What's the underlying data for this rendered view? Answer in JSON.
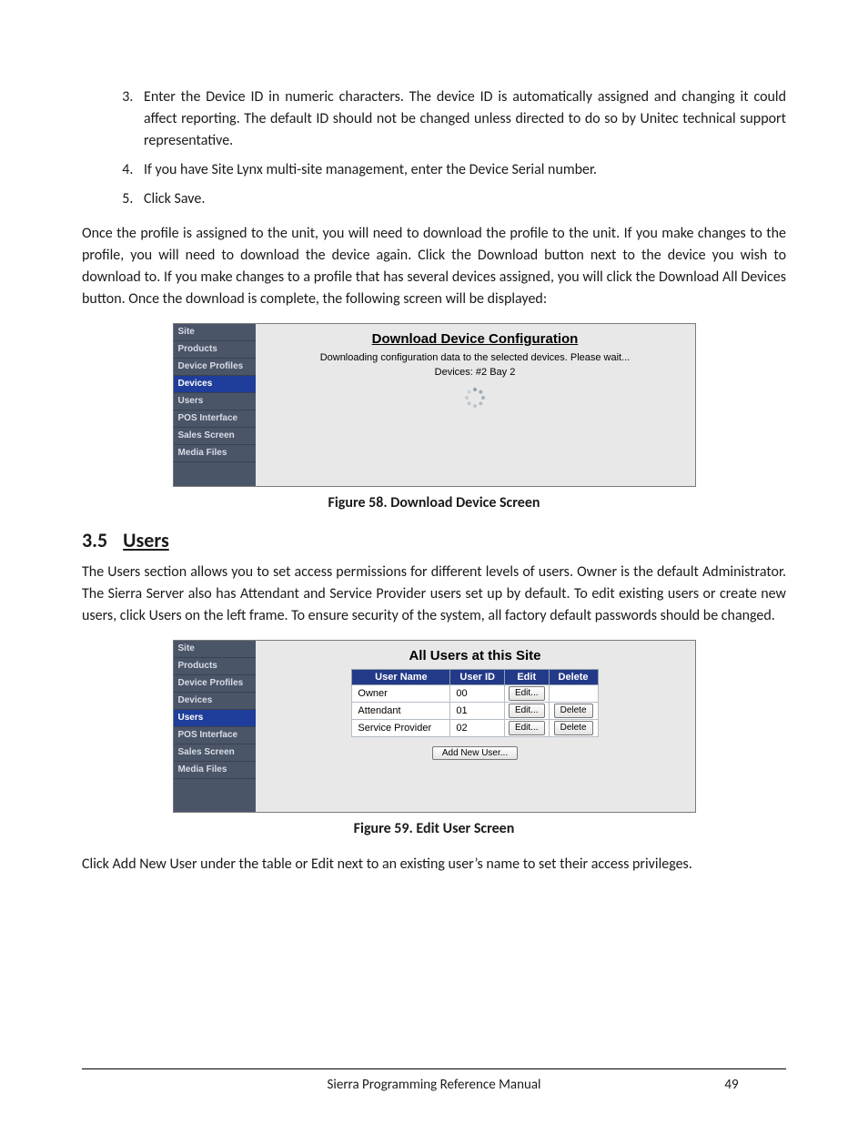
{
  "steps": [
    {
      "n": 3,
      "text": "Enter the Device ID in numeric characters. The device ID is automatically assigned and changing it could affect reporting. The default ID should not be changed unless directed to do so by Unitec technical support representative."
    },
    {
      "n": 4,
      "text": "If you have Site Lynx multi-site management, enter the Device Serial number."
    },
    {
      "n": 5,
      "text": "Click Save."
    }
  ],
  "para1": "Once the profile is assigned to the unit, you will need to download the profile to the unit. If you make changes to the profile, you will need to download the device again. Click the Download button next to the device you wish to download to. If you make changes to a profile that has several devices assigned, you will click the Download All Devices button. Once the download is complete, the following screen will be displayed:",
  "fig58": {
    "sidebar": [
      "Site",
      "Products",
      "Device Profiles",
      "Devices",
      "Users",
      "POS Interface",
      "Sales Screen",
      "Media Files"
    ],
    "active": "Devices",
    "title": "Download Device Configuration",
    "message": "Downloading configuration data to the selected devices. Please wait...",
    "devices": "Devices:  #2 Bay 2",
    "caption": "Figure 58. Download Device Screen"
  },
  "section": {
    "num": "3.5",
    "title": "Users"
  },
  "para2": "The Users section allows you to set access permissions for different levels of users. Owner is the default Administrator. The Sierra Server also has Attendant and Service Provider users set up by default. To edit existing users or create new users, click Users on the left frame. To ensure security of the system, all factory default passwords should be changed.",
  "fig59": {
    "sidebar": [
      "Site",
      "Products",
      "Device Profiles",
      "Devices",
      "Users",
      "POS Interface",
      "Sales Screen",
      "Media Files"
    ],
    "active": "Users",
    "title": "All Users at this Site",
    "columns": [
      "User Name",
      "User ID",
      "Edit",
      "Delete"
    ],
    "rows": [
      {
        "name": "Owner",
        "id": "00",
        "edit": "Edit...",
        "delete": ""
      },
      {
        "name": "Attendant",
        "id": "01",
        "edit": "Edit...",
        "delete": "Delete"
      },
      {
        "name": "Service Provider",
        "id": "02",
        "edit": "Edit...",
        "delete": "Delete"
      }
    ],
    "add": "Add New User...",
    "caption": "Figure 59. Edit User Screen"
  },
  "para3": "Click Add New User under the table or Edit next to an existing user’s name to set their access privileges.",
  "footer": {
    "title": "Sierra Programming Reference Manual",
    "page": "49"
  }
}
